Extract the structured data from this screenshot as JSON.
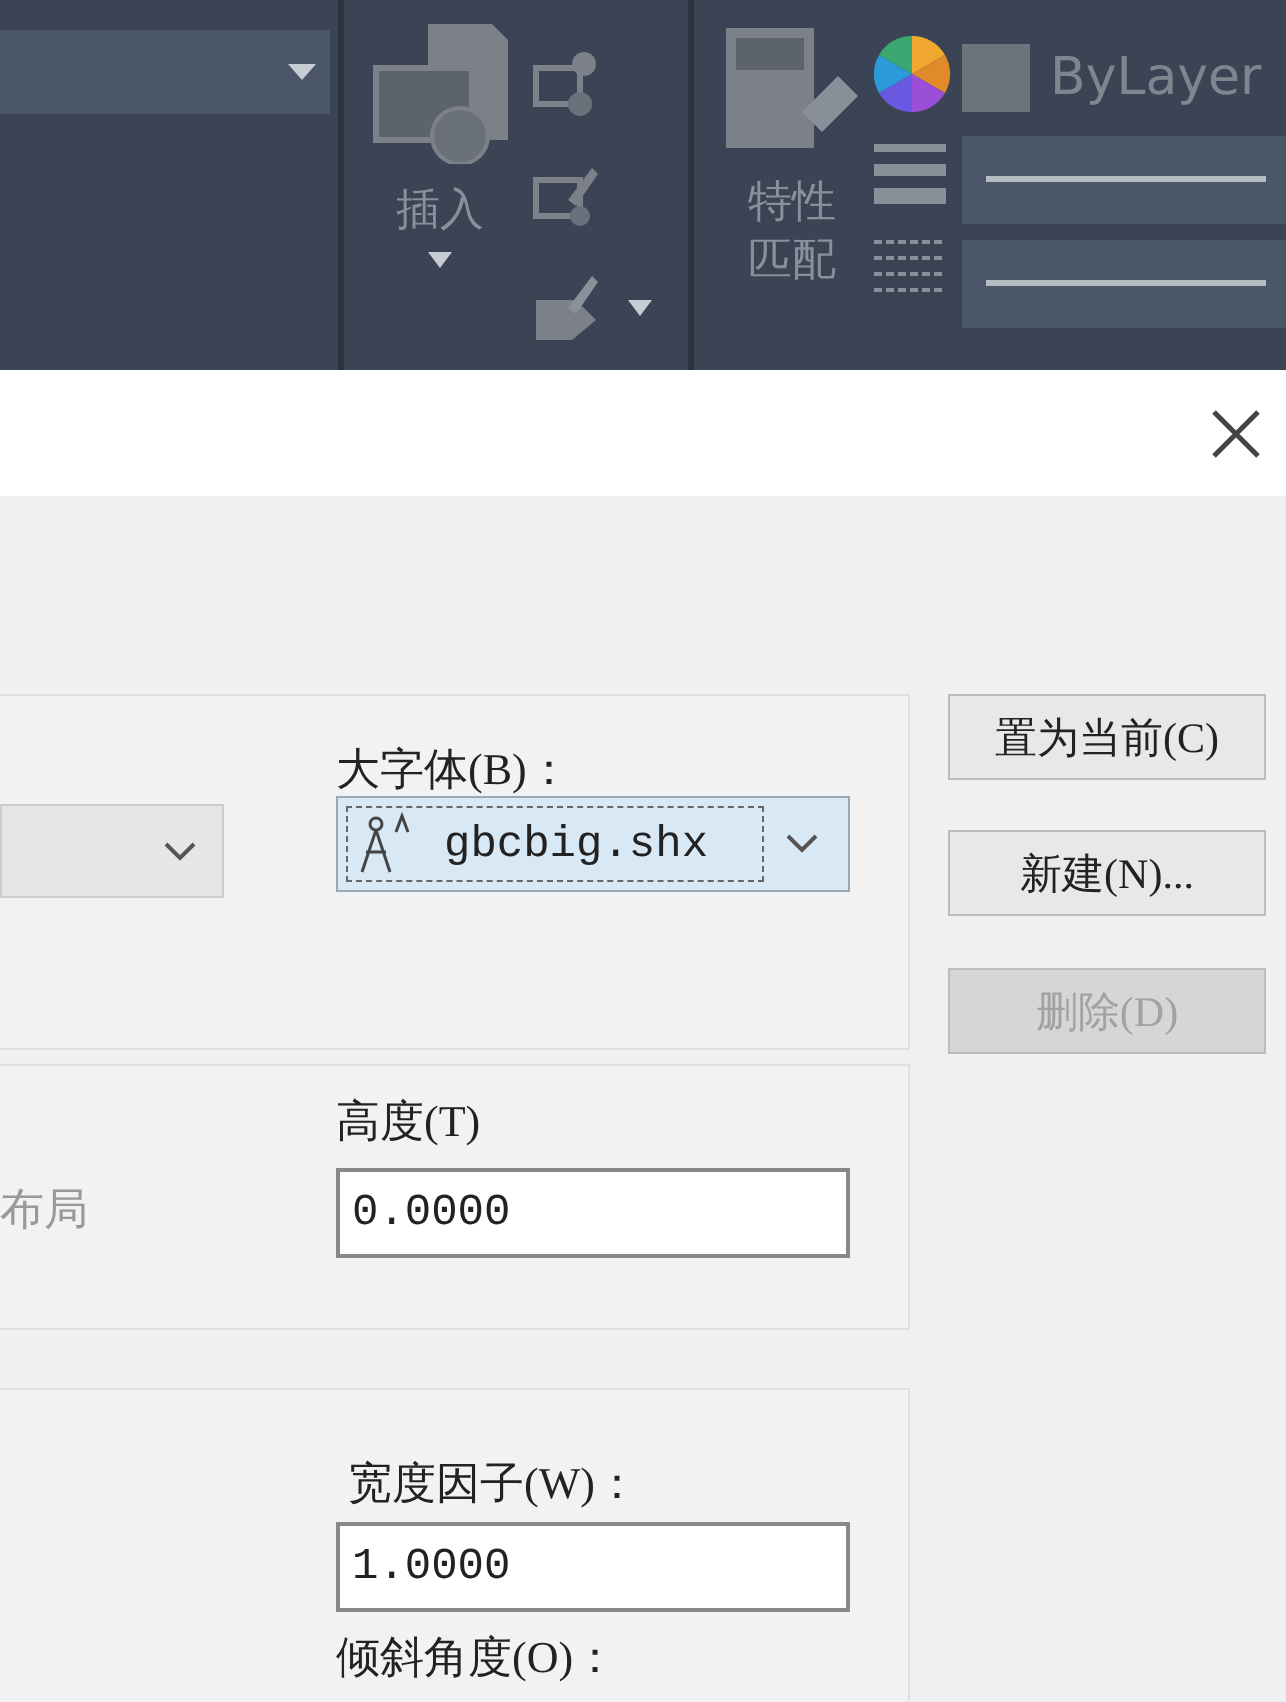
{
  "ribbon": {
    "insert_label": "插入",
    "match_label": "特性匹配",
    "color_label": "ByLayer"
  },
  "dialog": {
    "font": {
      "font_combo": {
        "disabled": true
      },
      "bigfont_label": "大字体(B)：",
      "bigfont_combo": {
        "value": "gbcbig.shx",
        "selected": true
      }
    },
    "size": {
      "layout_label": "布局",
      "layout_disabled": true,
      "height_label": "高度(T)",
      "height_value": "0.0000"
    },
    "effects": {
      "width_label": "宽度因子(W)：",
      "width_value": "1.0000",
      "oblique_label": "倾斜角度(O)："
    },
    "buttons": [
      {
        "label": "置为当前(C)",
        "disabled": false
      },
      {
        "label": "新建(N)...",
        "disabled": false
      },
      {
        "label": "删除(D)",
        "disabled": true
      }
    ]
  }
}
